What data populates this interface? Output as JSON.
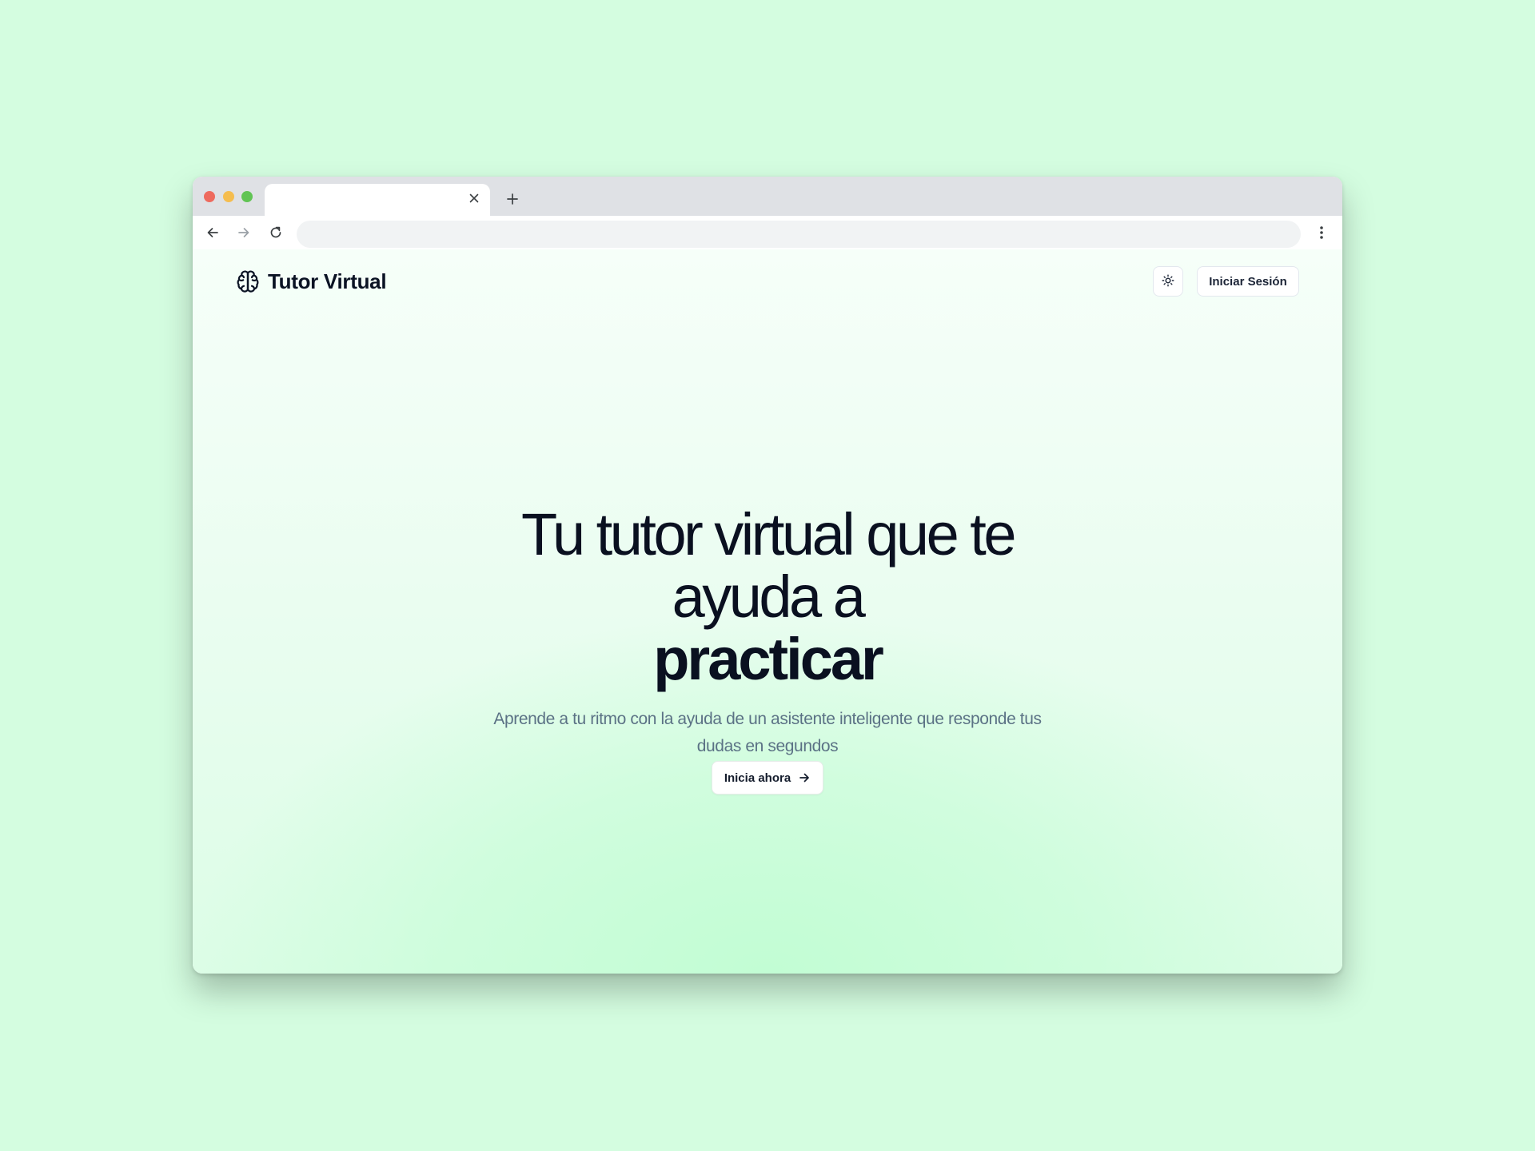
{
  "browser": {
    "tab": {
      "title": "",
      "close_icon": "close-icon"
    },
    "new_tab_icon": "plus-icon",
    "nav": {
      "back_icon": "arrow-left-icon",
      "forward_icon": "arrow-right-icon",
      "reload_icon": "reload-icon"
    },
    "address": {
      "value": "",
      "placeholder": ""
    },
    "menu_icon": "kebab-menu-icon",
    "traffic_lights": {
      "close_color": "#ee6a5e",
      "minimize_color": "#f5bd4f",
      "maximize_color": "#61c454"
    }
  },
  "site": {
    "brand": {
      "logo_icon": "brain-icon",
      "name": "Tutor Virtual"
    },
    "header": {
      "theme_toggle_icon": "sun-icon",
      "login_label": "Iniciar Sesión"
    },
    "hero": {
      "title_line_1": "Tu tutor virtual que te",
      "title_line_2": "ayuda a",
      "title_emphasis": "practicar",
      "subtitle": "Aprende a tu ritmo con la ayuda de un asistente inteligente que responde tus dudas en segundos",
      "cta_label": "Inicia ahora",
      "cta_icon": "arrow-right-icon"
    },
    "colors": {
      "page_background": "#d4fde0",
      "hero_glow": "#c2fdd4",
      "heading": "#0a1020",
      "subtitle": "#5b7285"
    }
  }
}
